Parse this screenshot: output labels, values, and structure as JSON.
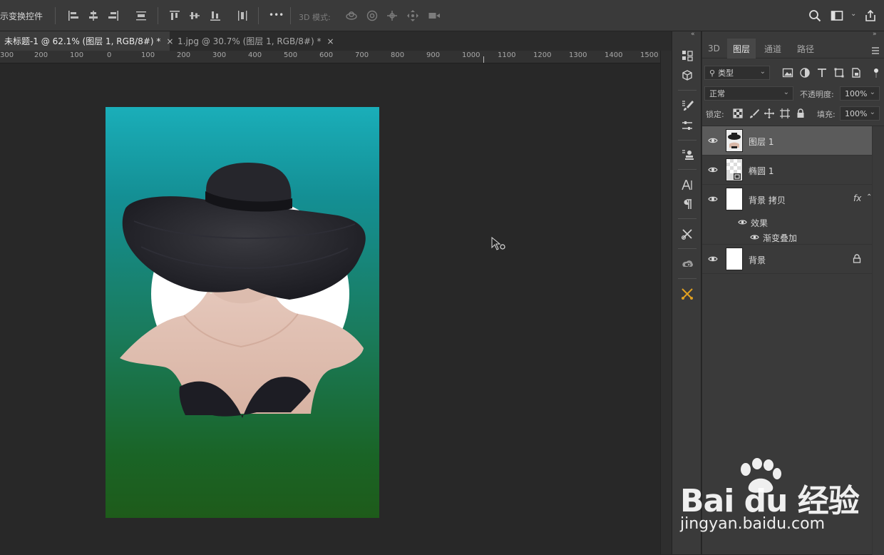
{
  "optionsBar": {
    "transformLabel": "示变换控件",
    "more": "•••",
    "mode3d": "3D 模式:"
  },
  "tabs": [
    {
      "label": "未标题-1 @ 62.1% (图层 1, RGB/8#) *",
      "close": "×",
      "active": true
    },
    {
      "label": "1.jpg @ 30.7% (图层 1, RGB/8#) *",
      "close": "×",
      "active": false
    }
  ],
  "ruler": {
    "labels": [
      "300",
      "200",
      "100",
      "0",
      "100",
      "200",
      "300",
      "400",
      "500",
      "600",
      "700",
      "800",
      "900",
      "1000",
      "1100",
      "1200",
      "1300",
      "1400",
      "1500"
    ]
  },
  "panel": {
    "tabs": [
      "3D",
      "图层",
      "通道",
      "路径"
    ],
    "activeTab": "图层",
    "filter": "类型",
    "blendMode": "正常",
    "opacityLabel": "不透明度:",
    "opacityValue": "100%",
    "lockLabel": "锁定:",
    "fillLabel": "填充:",
    "fillValue": "100%",
    "layers": [
      {
        "name": "图层 1",
        "selected": true
      },
      {
        "name": "椭圆 1",
        "selected": false
      },
      {
        "name": "背景 拷贝",
        "selected": false,
        "fx": "fx"
      },
      {
        "name": "背景",
        "selected": false
      }
    ],
    "effectsLabel": "效果",
    "gradientOverlayLabel": "渐变叠加"
  },
  "watermark": {
    "brand": "Bai du 经验",
    "url": "jingyan.baidu.com"
  },
  "colors": {
    "accent": "#1aaeb9",
    "docTop": "#1aaeb9",
    "docBottom": "#1e5b1a"
  }
}
